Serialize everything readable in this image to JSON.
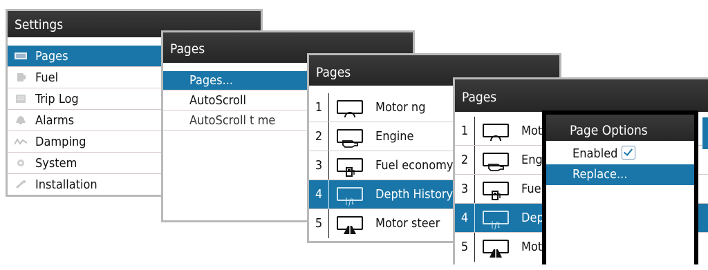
{
  "settings": {
    "title": "Settings",
    "items": [
      {
        "label": "Pages",
        "icon": "pages-icon",
        "selected": true
      },
      {
        "label": "Fuel",
        "icon": "fuel-icon",
        "selected": false
      },
      {
        "label": "Trip Log",
        "icon": "trip-log-icon",
        "selected": false
      },
      {
        "label": "Alarms",
        "icon": "bell-icon",
        "selected": false
      },
      {
        "label": "Damping",
        "icon": "damping-icon",
        "selected": false
      },
      {
        "label": "System",
        "icon": "gear-icon",
        "selected": false
      },
      {
        "label": "Installation",
        "icon": "wrench-icon",
        "selected": false
      }
    ]
  },
  "pages_menu": {
    "title": "Pages",
    "items": [
      {
        "label": "Pages...",
        "selected": true
      },
      {
        "label": "AutoScroll",
        "selected": false
      },
      {
        "label": "AutoScroll t me",
        "selected": false
      }
    ]
  },
  "pages_list": {
    "title": "Pages",
    "items": [
      {
        "num": "1",
        "label": "Motor ng",
        "icon": "motoring-icon"
      },
      {
        "num": "2",
        "label": "Engine",
        "icon": "engine-icon"
      },
      {
        "num": "3",
        "label": "Fuel economy",
        "icon": "fuel-economy-icon"
      },
      {
        "num": "4",
        "label": "Depth History",
        "icon": "depth-history-icon",
        "selected": true
      },
      {
        "num": "5",
        "label": "Motor steer",
        "icon": "motor-steer-icon"
      }
    ]
  },
  "pages_list_2": {
    "title": "Pages",
    "items": [
      {
        "num": "1",
        "label": "Mot"
      },
      {
        "num": "2",
        "label": "Eng"
      },
      {
        "num": "3",
        "label": "Fue"
      },
      {
        "num": "4",
        "label": "Dep",
        "selected": true
      },
      {
        "num": "5",
        "label": "Mot"
      }
    ]
  },
  "page_options": {
    "title": "Page Options",
    "enabled_label": "Enabled",
    "enabled": true,
    "replace_label": "Replace..."
  },
  "colors": {
    "accent": "#1a76a8",
    "titlebar": "#2e2e2e",
    "frame": "#b9b9b9"
  }
}
